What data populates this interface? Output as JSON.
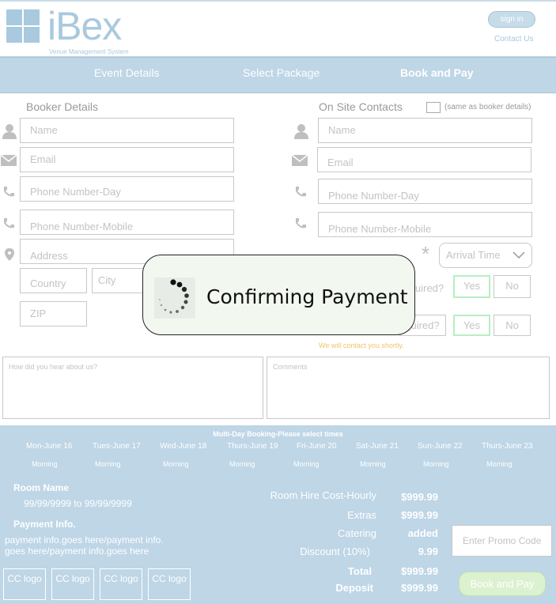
{
  "header": {
    "logo_text": "iBex",
    "logo_subtitle": "Venue Management System",
    "signin_label": "sign in",
    "contact_label": "Contact Us"
  },
  "steps": [
    "Event Details",
    "Select Package",
    "Book and Pay"
  ],
  "booker": {
    "title": "Booker Details",
    "name_placeholder": "Name",
    "email_placeholder": "Email",
    "phone_day_placeholder": "Phone Number-Day",
    "phone_mobile_placeholder": "Phone Number-Mobile",
    "address_placeholder": "Address",
    "country_placeholder": "Country",
    "city_placeholder": "City",
    "zip_placeholder": "ZIP"
  },
  "onsite": {
    "title": "On Site Contacts",
    "same_as_label": "(same as booker details)",
    "name_placeholder": "Name",
    "email_placeholder": "Email",
    "phone_day_placeholder": "Phone Number-Day",
    "phone_mobile_placeholder": "Phone Number-Mobile",
    "required_marker": "*",
    "arrival_time": "Arrival Time",
    "question1_tail": "uired?",
    "question2_tail": "equired?",
    "yes": "Yes",
    "no": "No",
    "contact_note": "We will contact you shortly."
  },
  "textareas": {
    "hear_about_placeholder": "How did you hear about us?",
    "comments_placeholder": "Comments"
  },
  "booking": {
    "multi_day_title": "Multi-Day Booking-Please select times",
    "days": [
      "Mon-June 16",
      "Tues-June 17",
      "Wed-June 18",
      "Thurs-June 19",
      "Fri-June 20",
      "Sat-June 21",
      "Sun-June 22",
      "Thurs-June 23"
    ],
    "slot": "Morning",
    "room_name_label": "Room Name",
    "room_dates": "99/99/9999 to 99/99/9999",
    "payment_info_label": "Payment Info.",
    "payment_info_text": "payment info.goes here/payment info. goes here/payment info.goes here",
    "cc_logo": "CC logo",
    "costs": [
      {
        "label": "Room Hire Cost-Hourly",
        "value": "$999.99"
      },
      {
        "label": "Extras",
        "value": "$999.99"
      },
      {
        "label": "Catering",
        "value": "added"
      },
      {
        "label": "Discount (10%)",
        "value": "9.99"
      },
      {
        "label": "Total",
        "value": "$999.99"
      },
      {
        "label": "Deposit",
        "value": "$999.99"
      }
    ],
    "promo_placeholder": "Enter Promo Code",
    "book_and_pay": "Book and Pay"
  },
  "modal": {
    "text": "Confirming Payment"
  }
}
